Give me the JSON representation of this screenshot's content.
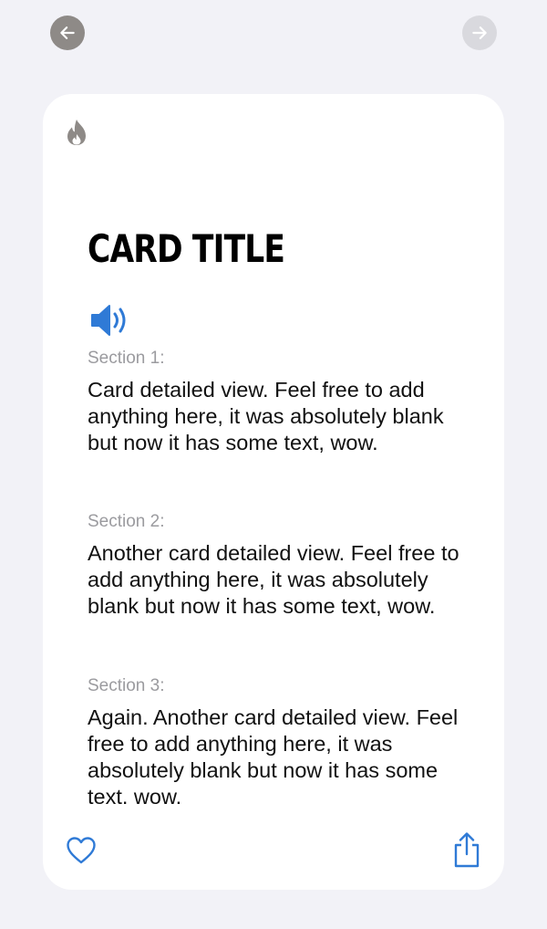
{
  "colors": {
    "background": "#f2f2f7",
    "card": "#ffffff",
    "accent": "#2f7ad6",
    "nav_back_bg": "#8e8a87",
    "nav_forward_bg": "#d9d9de",
    "flame": "#8e8a87"
  },
  "icons": {
    "back": "arrow-left-icon",
    "forward": "arrow-right-icon",
    "flame": "flame-icon",
    "speaker": "speaker-icon",
    "like": "heart-icon",
    "share": "share-icon"
  },
  "card": {
    "title": "CARD TITLE",
    "sections": [
      {
        "label": "Section 1:",
        "body": "Card detailed view. Feel free to add anything here, it was absolutely blank but now it has some text, wow."
      },
      {
        "label": "Section 2:",
        "body": "Another card detailed view. Feel free to add anything here, it was absolutely blank but now it has some text, wow."
      },
      {
        "label": "Section 3:",
        "body": "Again. Another card detailed view. Feel free to add anything here, it was absolutely blank but now it has some text. wow."
      }
    ]
  }
}
